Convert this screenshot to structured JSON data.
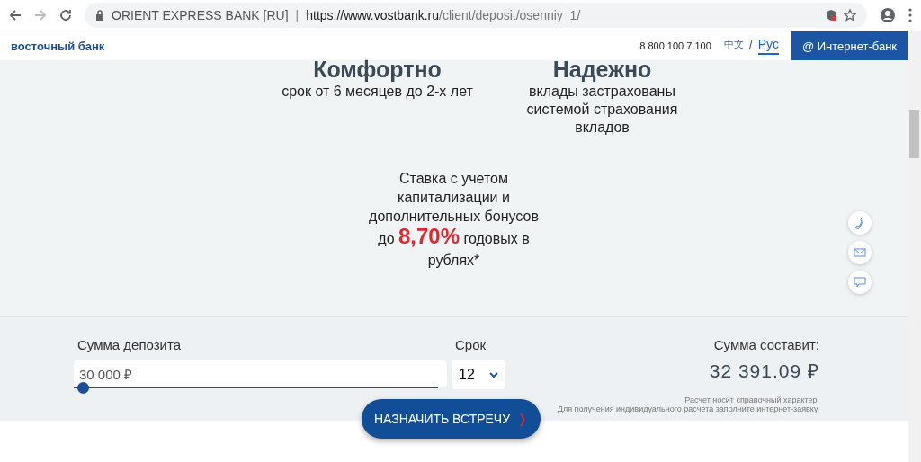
{
  "browser": {
    "site_name": "ORIENT EXPRESS BANK [RU]",
    "url_host": "https://www.vostbank.ru",
    "url_path": "/client/deposit/osenniy_1/"
  },
  "header": {
    "logo": "восточный банк",
    "phone": "8 800 100 7 100",
    "languages": [
      {
        "label": "中文",
        "selected": false
      },
      {
        "label": "Рус",
        "selected": true
      }
    ],
    "separator": "/",
    "url_divider": "|",
    "bank_button": "@ Интернет-банк"
  },
  "features": [
    {
      "title": "Комфортно",
      "text": "срок от 6 месяцев до 2-х лет"
    },
    {
      "title": "Надежно",
      "text": "вклады застрахованы системой страхования вкладов"
    }
  ],
  "rate": {
    "text": "Ставка с учетом капитализации и дополнительных бонусов",
    "line": "до **8,70%** годовых в рублях*"
  },
  "calculator": {
    "amount_label": "Сумма депозита",
    "amount_value": "30 000 ₽",
    "amount_slider": {
      "level": 0
    },
    "term_label": "Срок",
    "term_value": "12",
    "result_label": "Сумма составит:",
    "result_value": "32 391.09 ₽",
    "note_1": "Расчет носит справочный характер.",
    "note_2": "Для получения индивидуального расчета заполните интернет-заявку.",
    "cta": "НАЗНАЧИТЬ ВСТРЕЧУ",
    "cta_arrow": "❭"
  }
}
